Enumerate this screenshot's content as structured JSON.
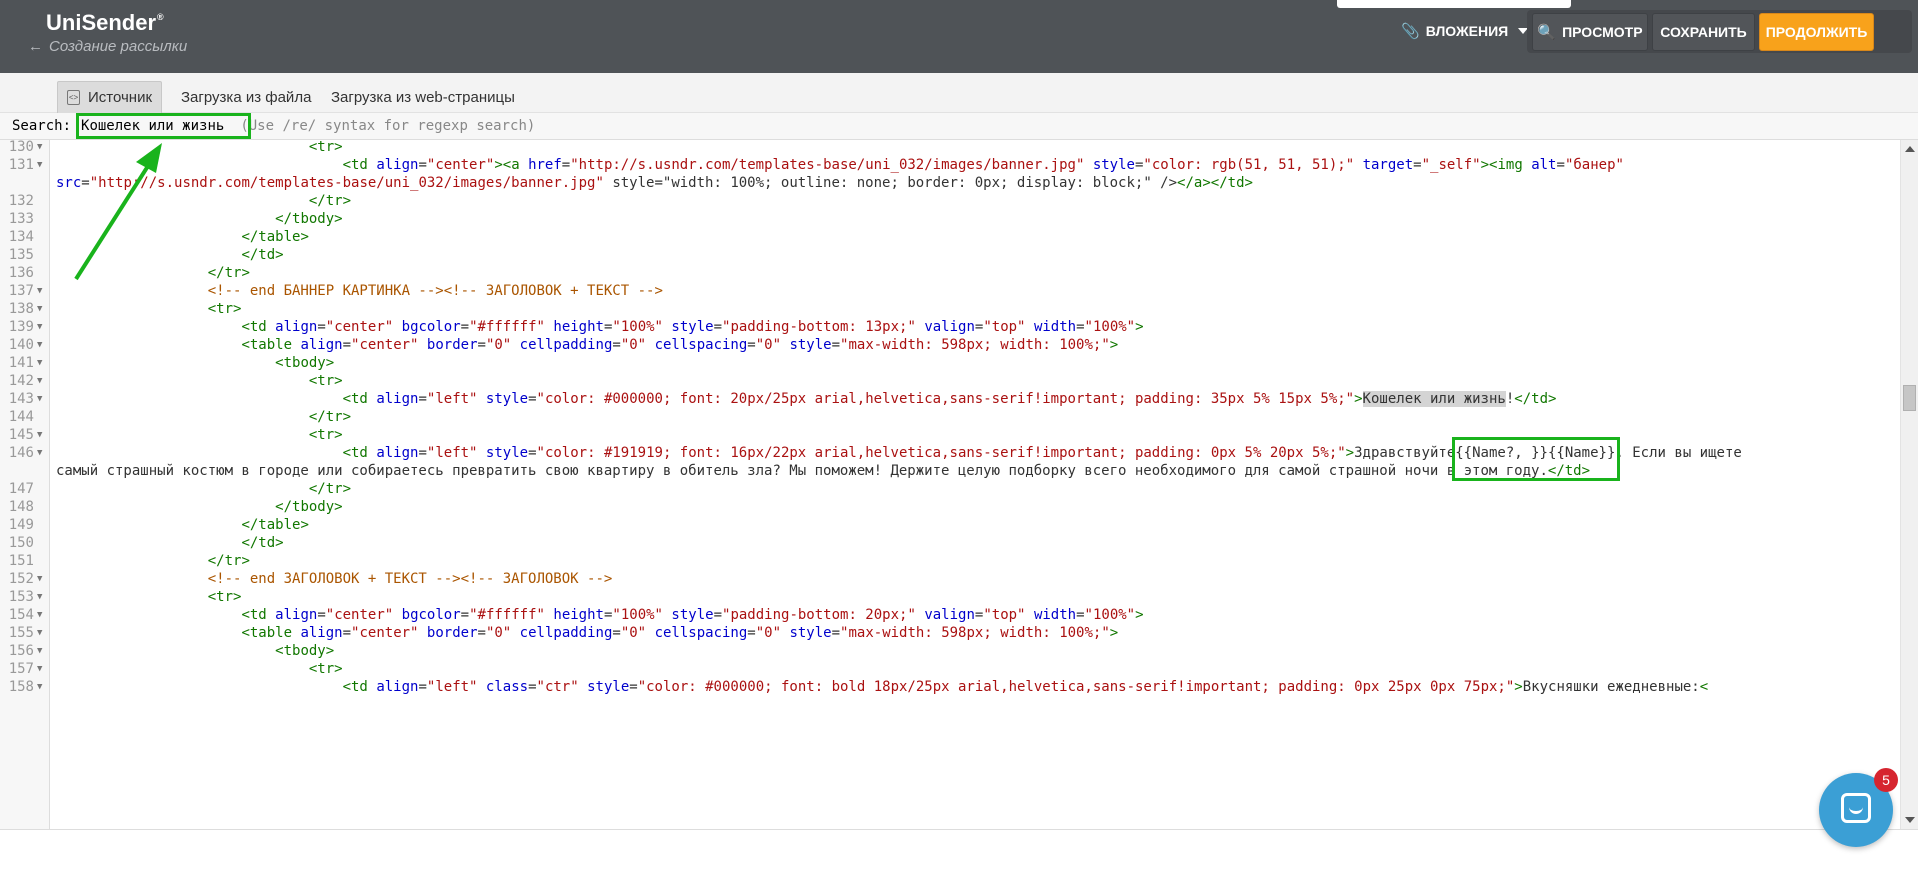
{
  "header": {
    "logo": "UniSender",
    "logo_reg": "®",
    "back_link": "Создание рассылки",
    "attachments_label": "ВЛОЖЕНИЯ",
    "preview_label": "ПРОСМОТР",
    "save_label": "СОХРАНИТЬ",
    "continue_label": "ПРОДОЛЖИТЬ"
  },
  "tabs": [
    "Источник",
    "Загрузка из файла",
    "Загрузка из web-страницы"
  ],
  "search": {
    "label": "Search:",
    "value": "Кошелек или жизнь",
    "hint": "(Use /re/ syntax for regexp search)"
  },
  "chat": {
    "badge": "5"
  },
  "colors": {
    "topbar": "#4f5357",
    "accent": "#f8a21b",
    "annotation": "#19b31c"
  },
  "code_lines": [
    {
      "n": "130",
      "fold": true,
      "text": "                              <tr>"
    },
    {
      "n": "131",
      "fold": true,
      "text": "                                  <td align=\"center\"><a href=\"http://s.usndr.com/templates-base/uni_032/images/banner.jpg\" style=\"color: rgb(51, 51, 51);\" target=\"_self\"><img alt=\"банер\""
    },
    {
      "n": "",
      "fold": false,
      "text": "src=\"http://s.usndr.com/templates-base/uni_032/images/banner.jpg\" style=\"width: 100%; outline: none; border: 0px; display: block;\" /></a></td>"
    },
    {
      "n": "132",
      "fold": false,
      "text": "                              </tr>"
    },
    {
      "n": "133",
      "fold": false,
      "text": "                          </tbody>"
    },
    {
      "n": "134",
      "fold": false,
      "text": "                      </table>"
    },
    {
      "n": "135",
      "fold": false,
      "text": "                      </td>"
    },
    {
      "n": "136",
      "fold": false,
      "text": "                  </tr>"
    },
    {
      "n": "137",
      "fold": true,
      "text": "                  <!-- end БАННЕР КАРТИНКА --><!-- ЗАГОЛОВОК + ТЕКСТ -->"
    },
    {
      "n": "138",
      "fold": true,
      "text": "                  <tr>"
    },
    {
      "n": "139",
      "fold": true,
      "text": "                      <td align=\"center\" bgcolor=\"#ffffff\" height=\"100%\" style=\"padding-bottom: 13px;\" valign=\"top\" width=\"100%\">"
    },
    {
      "n": "140",
      "fold": true,
      "text": "                      <table align=\"center\" border=\"0\" cellpadding=\"0\" cellspacing=\"0\" style=\"max-width: 598px; width: 100%;\">"
    },
    {
      "n": "141",
      "fold": true,
      "text": "                          <tbody>"
    },
    {
      "n": "142",
      "fold": true,
      "text": "                              <tr>"
    },
    {
      "n": "143",
      "fold": true,
      "text": "                                  <td align=\"left\" style=\"color: #000000; font: 20px/25px arial,helvetica,sans-serif!important; padding: 35px 5% 15px 5%;\">Кошелек или жизнь!</td>"
    },
    {
      "n": "144",
      "fold": false,
      "text": "                              </tr>"
    },
    {
      "n": "145",
      "fold": true,
      "text": "                              <tr>"
    },
    {
      "n": "146",
      "fold": true,
      "text": "                                  <td align=\"left\" style=\"color: #191919; font: 16px/22px arial,helvetica,sans-serif!important; padding: 0px 5% 20px 5%;\">Здравствуйте{{Name?, }}{{Name}}. Если вы ищете"
    },
    {
      "n": "",
      "fold": false,
      "text": "самый страшный костюм в городе или собираетесь превратить свою квартиру в обитель зла? Мы поможем! Держите целую подборку всего необходимого для самой страшной ночи в этом году.</td>"
    },
    {
      "n": "147",
      "fold": false,
      "text": "                              </tr>"
    },
    {
      "n": "148",
      "fold": false,
      "text": "                          </tbody>"
    },
    {
      "n": "149",
      "fold": false,
      "text": "                      </table>"
    },
    {
      "n": "150",
      "fold": false,
      "text": "                      </td>"
    },
    {
      "n": "151",
      "fold": false,
      "text": "                  </tr>"
    },
    {
      "n": "152",
      "fold": true,
      "text": "                  <!-- end ЗАГОЛОВОК + ТЕКСТ --><!-- ЗАГОЛОВОК -->"
    },
    {
      "n": "153",
      "fold": true,
      "text": "                  <tr>"
    },
    {
      "n": "154",
      "fold": true,
      "text": "                      <td align=\"center\" bgcolor=\"#ffffff\" height=\"100%\" style=\"padding-bottom: 20px;\" valign=\"top\" width=\"100%\">"
    },
    {
      "n": "155",
      "fold": true,
      "text": "                      <table align=\"center\" border=\"0\" cellpadding=\"0\" cellspacing=\"0\" style=\"max-width: 598px; width: 100%;\">"
    },
    {
      "n": "156",
      "fold": true,
      "text": "                          <tbody>"
    },
    {
      "n": "157",
      "fold": true,
      "text": "                              <tr>"
    },
    {
      "n": "158",
      "fold": true,
      "text": "                                  <td align=\"left\" class=\"ctr\" style=\"color: #000000; font: bold 18px/25px arial,helvetica,sans-serif!important; padding: 0px 25px 0px 75px;\">Вкусняшки ежедневные:<"
    }
  ]
}
